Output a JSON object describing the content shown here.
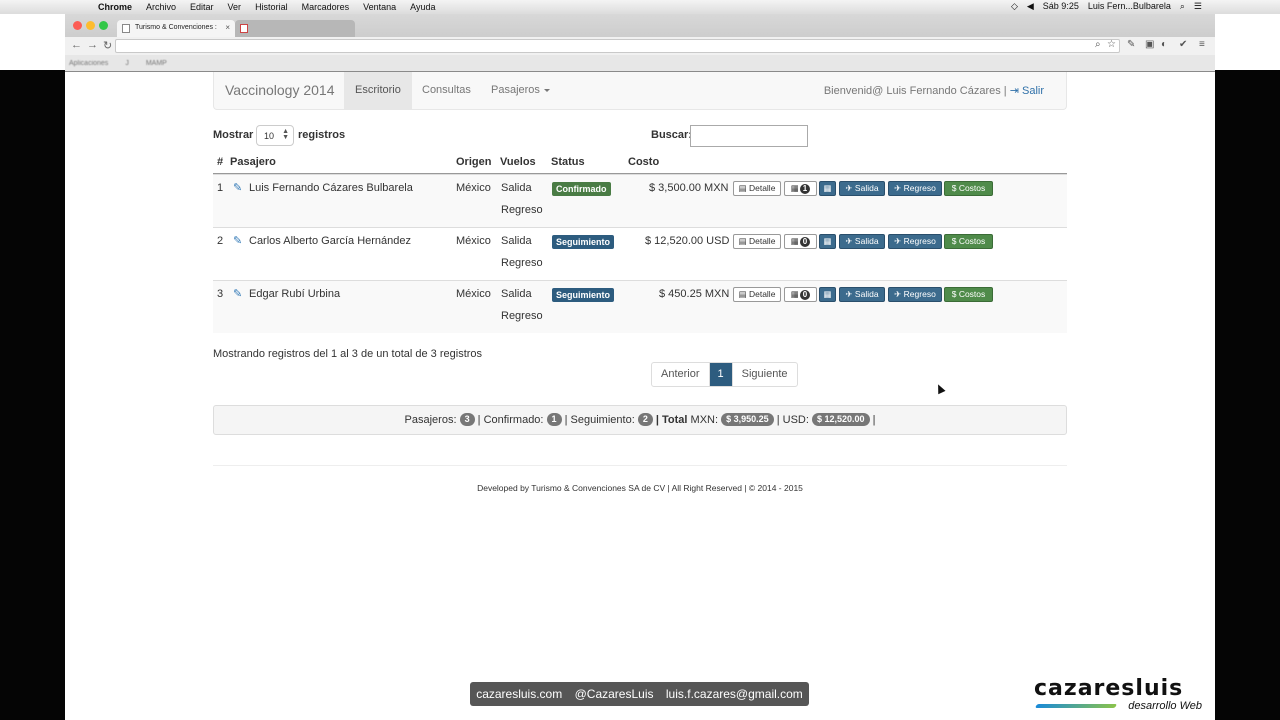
{
  "mac_menu": {
    "app_name": "Chrome",
    "items": [
      "Archivo",
      "Editar",
      "Ver",
      "Historial",
      "Marcadores",
      "Ventana",
      "Ayuda"
    ],
    "clock": "Sáb 9:25",
    "user": "Luis Fern...Bulbarela"
  },
  "browser": {
    "tab_active": "Turismo & Convenciones :",
    "tab_inactive": "",
    "bookmarks": [
      "Aplicaciones",
      "J",
      "",
      "",
      "",
      "",
      "MAMP",
      "",
      "",
      "",
      "",
      "",
      "",
      "",
      "",
      "",
      ""
    ]
  },
  "navbar": {
    "brand": "Vaccinology 2014",
    "links": [
      "Escritorio",
      "Consultas",
      "Pasajeros"
    ],
    "welcome": "Bienvenid@ Luis Fernando Cázares |",
    "logout": "Salir"
  },
  "controls": {
    "show_label": "Mostrar",
    "length_value": "10",
    "records_label": "registros",
    "search_label": "Buscar:",
    "search_value": ""
  },
  "table": {
    "headers": [
      "#",
      "Pasajero",
      "Origen",
      "Vuelos",
      "Status",
      "Costo"
    ],
    "rows": [
      {
        "num": "1",
        "name": "Luis Fernando Cázares Bulbarela",
        "origin": "México",
        "flight1": "Salida",
        "flight2": "Regreso",
        "status": "Confirmado",
        "cost": "$ 3,500.00 MXN",
        "count": "1"
      },
      {
        "num": "2",
        "name": "Carlos Alberto García Hernández",
        "origin": "México",
        "flight1": "Salida",
        "flight2": "Regreso",
        "status": "Seguimiento",
        "cost": "$ 12,520.00 USD",
        "count": "0"
      },
      {
        "num": "3",
        "name": "Edgar Rubí Urbina",
        "origin": "México",
        "flight1": "Salida",
        "flight2": "Regreso",
        "status": "Seguimiento",
        "cost": "$ 450.25 MXN",
        "count": "0"
      }
    ],
    "actions": {
      "detail": "Detalle",
      "departure": "Salida",
      "return": "Regreso",
      "costs": "Costos"
    }
  },
  "info": "Mostrando registros del 1 al 3 de un total de 3 registros",
  "pagination": {
    "prev": "Anterior",
    "current": "1",
    "next": "Siguiente"
  },
  "summary": {
    "passengers_label": "Pasajeros:",
    "passengers": "3",
    "confirmed_label": "| Confirmado:",
    "confirmed": "1",
    "followup_label": "| Seguimiento:",
    "followup": "2",
    "total_label": "| Total",
    "mxn_label": "MXN:",
    "mxn": "$ 3,950.25",
    "usd_label": "| USD:",
    "usd": "$ 12,520.00",
    "end": "|"
  },
  "footer": "Developed by Turismo & Convenciones SA de CV | All Right Reserved | © 2014 - 2015",
  "overlay": {
    "website": "cazaresluis.com",
    "twitter": "@CazaresLuis",
    "email": "luis.f.cazares@gmail.com",
    "logo_main": "cazaresluis",
    "logo_sub": "desarrollo Web"
  }
}
